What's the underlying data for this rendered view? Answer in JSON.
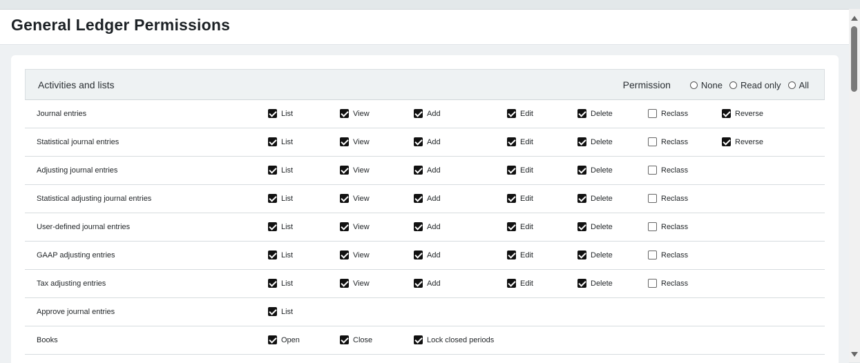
{
  "page": {
    "title": "General Ledger Permissions"
  },
  "table": {
    "header_label": "Activities and lists",
    "permission_label": "Permission",
    "permission_options": [
      "None",
      "Read only",
      "All"
    ]
  },
  "rows": [
    {
      "label": "Journal entries",
      "items": [
        {
          "label": "List",
          "checked": true
        },
        {
          "label": "View",
          "checked": true
        },
        {
          "label": "Add",
          "checked": true
        },
        {
          "label": "Edit",
          "checked": true
        },
        {
          "label": "Delete",
          "checked": true
        },
        {
          "label": "Reclass",
          "checked": false
        },
        {
          "label": "Reverse",
          "checked": true
        }
      ]
    },
    {
      "label": "Statistical journal entries",
      "items": [
        {
          "label": "List",
          "checked": true
        },
        {
          "label": "View",
          "checked": true
        },
        {
          "label": "Add",
          "checked": true
        },
        {
          "label": "Edit",
          "checked": true
        },
        {
          "label": "Delete",
          "checked": true
        },
        {
          "label": "Reclass",
          "checked": false
        },
        {
          "label": "Reverse",
          "checked": true
        }
      ]
    },
    {
      "label": "Adjusting journal entries",
      "items": [
        {
          "label": "List",
          "checked": true
        },
        {
          "label": "View",
          "checked": true
        },
        {
          "label": "Add",
          "checked": true
        },
        {
          "label": "Edit",
          "checked": true
        },
        {
          "label": "Delete",
          "checked": true
        },
        {
          "label": "Reclass",
          "checked": false
        }
      ]
    },
    {
      "label": "Statistical adjusting journal entries",
      "items": [
        {
          "label": "List",
          "checked": true
        },
        {
          "label": "View",
          "checked": true
        },
        {
          "label": "Add",
          "checked": true
        },
        {
          "label": "Edit",
          "checked": true
        },
        {
          "label": "Delete",
          "checked": true
        },
        {
          "label": "Reclass",
          "checked": false
        }
      ]
    },
    {
      "label": "User-defined journal entries",
      "items": [
        {
          "label": "List",
          "checked": true
        },
        {
          "label": "View",
          "checked": true
        },
        {
          "label": "Add",
          "checked": true
        },
        {
          "label": "Edit",
          "checked": true
        },
        {
          "label": "Delete",
          "checked": true
        },
        {
          "label": "Reclass",
          "checked": false
        }
      ]
    },
    {
      "label": "GAAP adjusting entries",
      "items": [
        {
          "label": "List",
          "checked": true
        },
        {
          "label": "View",
          "checked": true
        },
        {
          "label": "Add",
          "checked": true
        },
        {
          "label": "Edit",
          "checked": true
        },
        {
          "label": "Delete",
          "checked": true
        },
        {
          "label": "Reclass",
          "checked": false
        }
      ]
    },
    {
      "label": "Tax adjusting entries",
      "items": [
        {
          "label": "List",
          "checked": true
        },
        {
          "label": "View",
          "checked": true
        },
        {
          "label": "Add",
          "checked": true
        },
        {
          "label": "Edit",
          "checked": true
        },
        {
          "label": "Delete",
          "checked": true
        },
        {
          "label": "Reclass",
          "checked": false
        }
      ]
    },
    {
      "label": "Approve journal entries",
      "items": [
        {
          "label": "List",
          "checked": true
        }
      ]
    },
    {
      "label": "Books",
      "items": [
        {
          "label": "Open",
          "checked": true
        },
        {
          "label": "Close",
          "checked": true
        },
        {
          "label": "Lock closed periods",
          "checked": true
        }
      ]
    }
  ],
  "icons": {
    "checkbox_checked": "checkbox-checked-icon",
    "checkbox_unchecked": "checkbox-unchecked-icon",
    "radio": "radio-icon",
    "scroll_up": "scroll-up-arrow-icon",
    "scroll_down": "scroll-down-arrow-icon"
  },
  "colors": {
    "header_bg": "#eef2f3",
    "row_border": "#d6dbde",
    "checkbox": "#111111"
  }
}
